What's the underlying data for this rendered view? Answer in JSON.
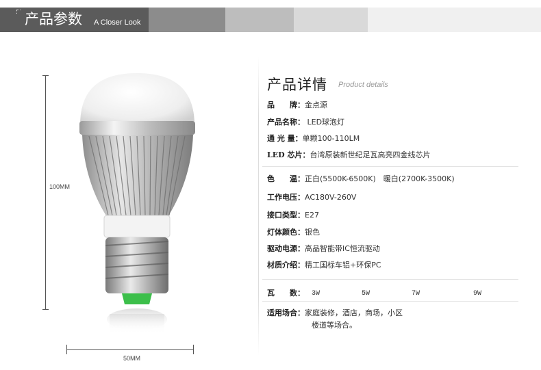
{
  "banner": {
    "title": "产品参数",
    "subtitle": "A Closer Look"
  },
  "product_image": {
    "height_label": "100MM",
    "width_label": "50MM"
  },
  "details": {
    "title": "产品详情",
    "subtitle": "Product details",
    "rows": [
      {
        "key": "品　　牌：",
        "value": "金点源"
      },
      {
        "key": "产品名称：",
        "value": " LED球泡灯"
      },
      {
        "key": "通 光 量：",
        "value": "单颗100-110LM"
      },
      {
        "key": "LED 芯片：",
        "value": "台湾原装新世纪足瓦高亮四金线芯片"
      },
      {
        "key": "色　　温：",
        "value": "正白(5500K-6500K)　暖白(2700K-3500K)"
      },
      {
        "key": "工作电压：",
        "value": "AC180V-260V"
      },
      {
        "key": "接口类型：",
        "value": "E27"
      },
      {
        "key": "灯体颜色：",
        "value": "银色"
      },
      {
        "key": "驱动电源：",
        "value": "高品智能带IC恒流驱动"
      },
      {
        "key": "材质介绍：",
        "value": "精工国标车铝+环保PC"
      }
    ],
    "wattage": {
      "key": "瓦　　数：",
      "values": [
        "3W",
        "5W",
        "7W",
        "9W"
      ]
    },
    "application": {
      "key": "适用场合：",
      "line1": "家庭装修，酒店，商场，小区",
      "line2": "楼道等场合。"
    }
  }
}
